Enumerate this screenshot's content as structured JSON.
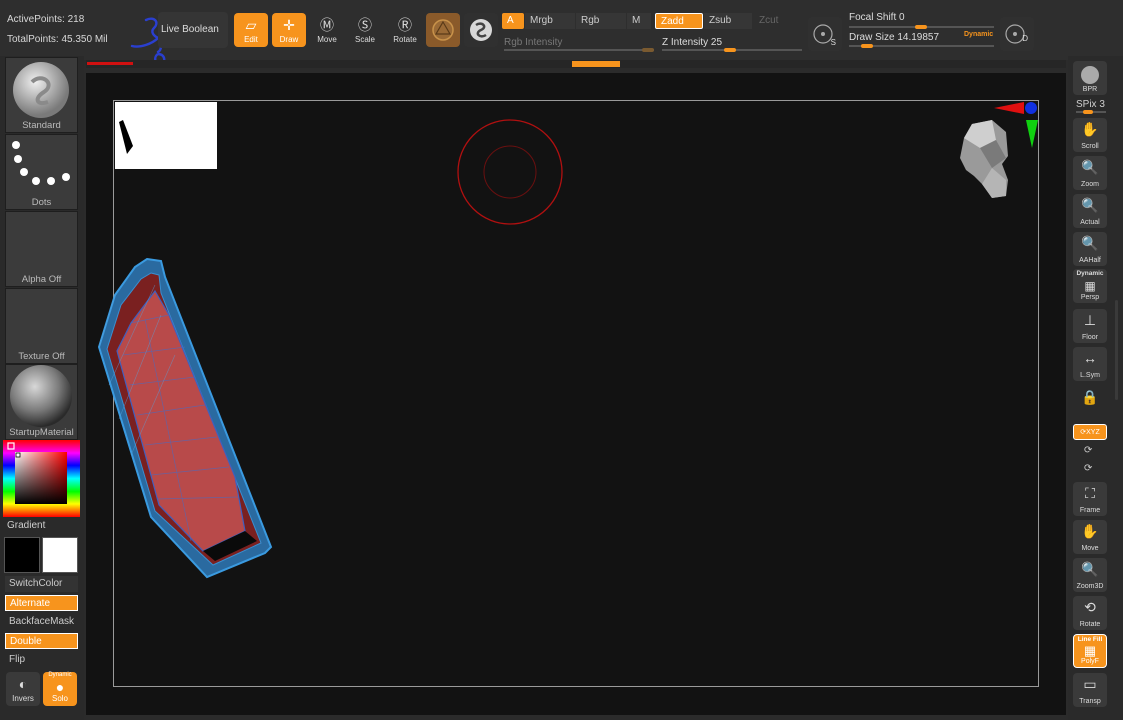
{
  "stats": {
    "active_points": "ActivePoints: 218",
    "total_points": "TotalPoints: 45.350 Mil"
  },
  "toolbar": {
    "live_boolean": "Live Boolean",
    "edit": "Edit",
    "draw": "Draw",
    "move": "Move",
    "scale": "Scale",
    "rotate": "Rotate",
    "a": "A",
    "mrgb": "Mrgb",
    "rgb": "Rgb",
    "m": "M",
    "zadd": "Zadd",
    "zsub": "Zsub",
    "zcut": "Zcut",
    "rgb_intensity": "Rgb Intensity",
    "z_intensity": "Z Intensity 25",
    "focal_shift": "Focal Shift 0",
    "draw_size": "Draw Size 14.19857",
    "dynamic": "Dynamic",
    "s_label": "S",
    "d_label": "D"
  },
  "left": {
    "standard": "Standard",
    "dots": "Dots",
    "alpha_off": "Alpha Off",
    "texture_off": "Texture Off",
    "startup_material": "StartupMaterial",
    "gradient": "Gradient",
    "switch_color": "SwitchColor",
    "alternate": "Alternate",
    "backface_mask": "BackfaceMask",
    "double": "Double",
    "flip": "Flip",
    "invers": "Invers",
    "dynamic": "Dynamic",
    "solo": "Solo"
  },
  "right": {
    "bpr": "BPR",
    "spix": "SPix 3",
    "scroll": "Scroll",
    "zoom": "Zoom",
    "actual": "Actual",
    "aahalf": "AAHalf",
    "dynamic": "Dynamic",
    "persp": "Persp",
    "floor": "Floor",
    "lsym": "L.Sym",
    "xyz": "XYZ",
    "frame": "Frame",
    "move": "Move",
    "zoom3d": "Zoom3D",
    "rotate": "Rotate",
    "line_fill": "Line Fill",
    "polyf": "PolyF",
    "transp": "Transp"
  },
  "colors": {
    "accent": "#f7941d",
    "canvas": "#121212",
    "mesh_fill": "#b84a4a",
    "mesh_wire": "#3a8fd0"
  }
}
